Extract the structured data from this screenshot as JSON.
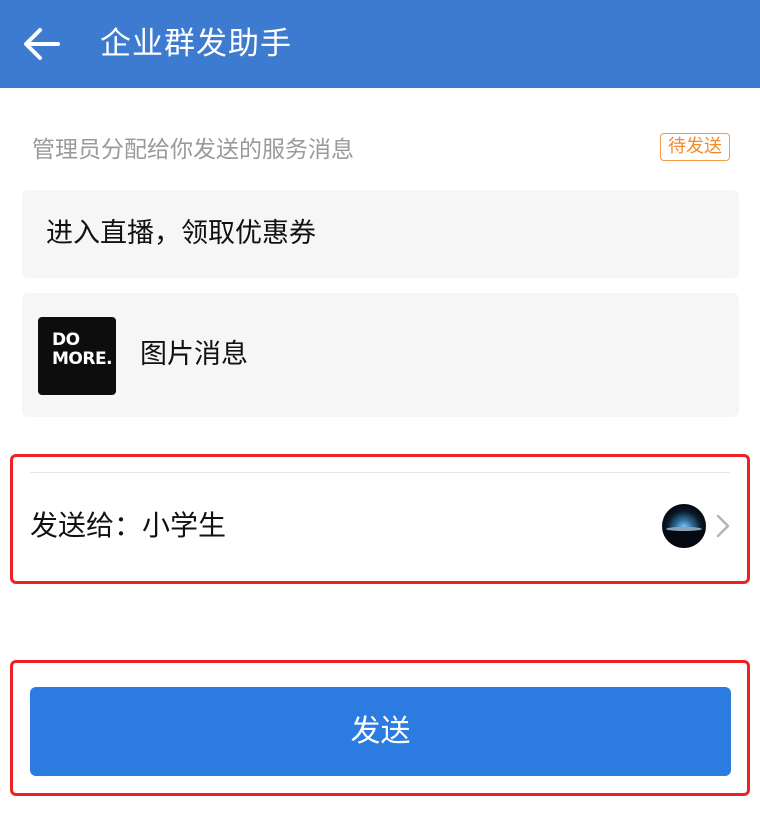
{
  "header": {
    "title": "企业群发助手",
    "back_icon": "arrow-left-icon",
    "background_color": "#3d7bd0"
  },
  "content": {
    "subtitle": "管理员分配给你发送的服务消息",
    "status_badge": "待发送",
    "status_color": "#f08a30",
    "text_message": "进入直播，领取优惠券",
    "image_message": {
      "thumbnail_text": "DO\nMORE.",
      "label": "图片消息"
    }
  },
  "recipient": {
    "label": "发送给：小学生",
    "avatar": "avatar-image",
    "chevron_icon": "chevron-right-icon"
  },
  "actions": {
    "send_label": "发送",
    "button_color": "#2b7be0"
  },
  "highlight_color": "#ee2222"
}
